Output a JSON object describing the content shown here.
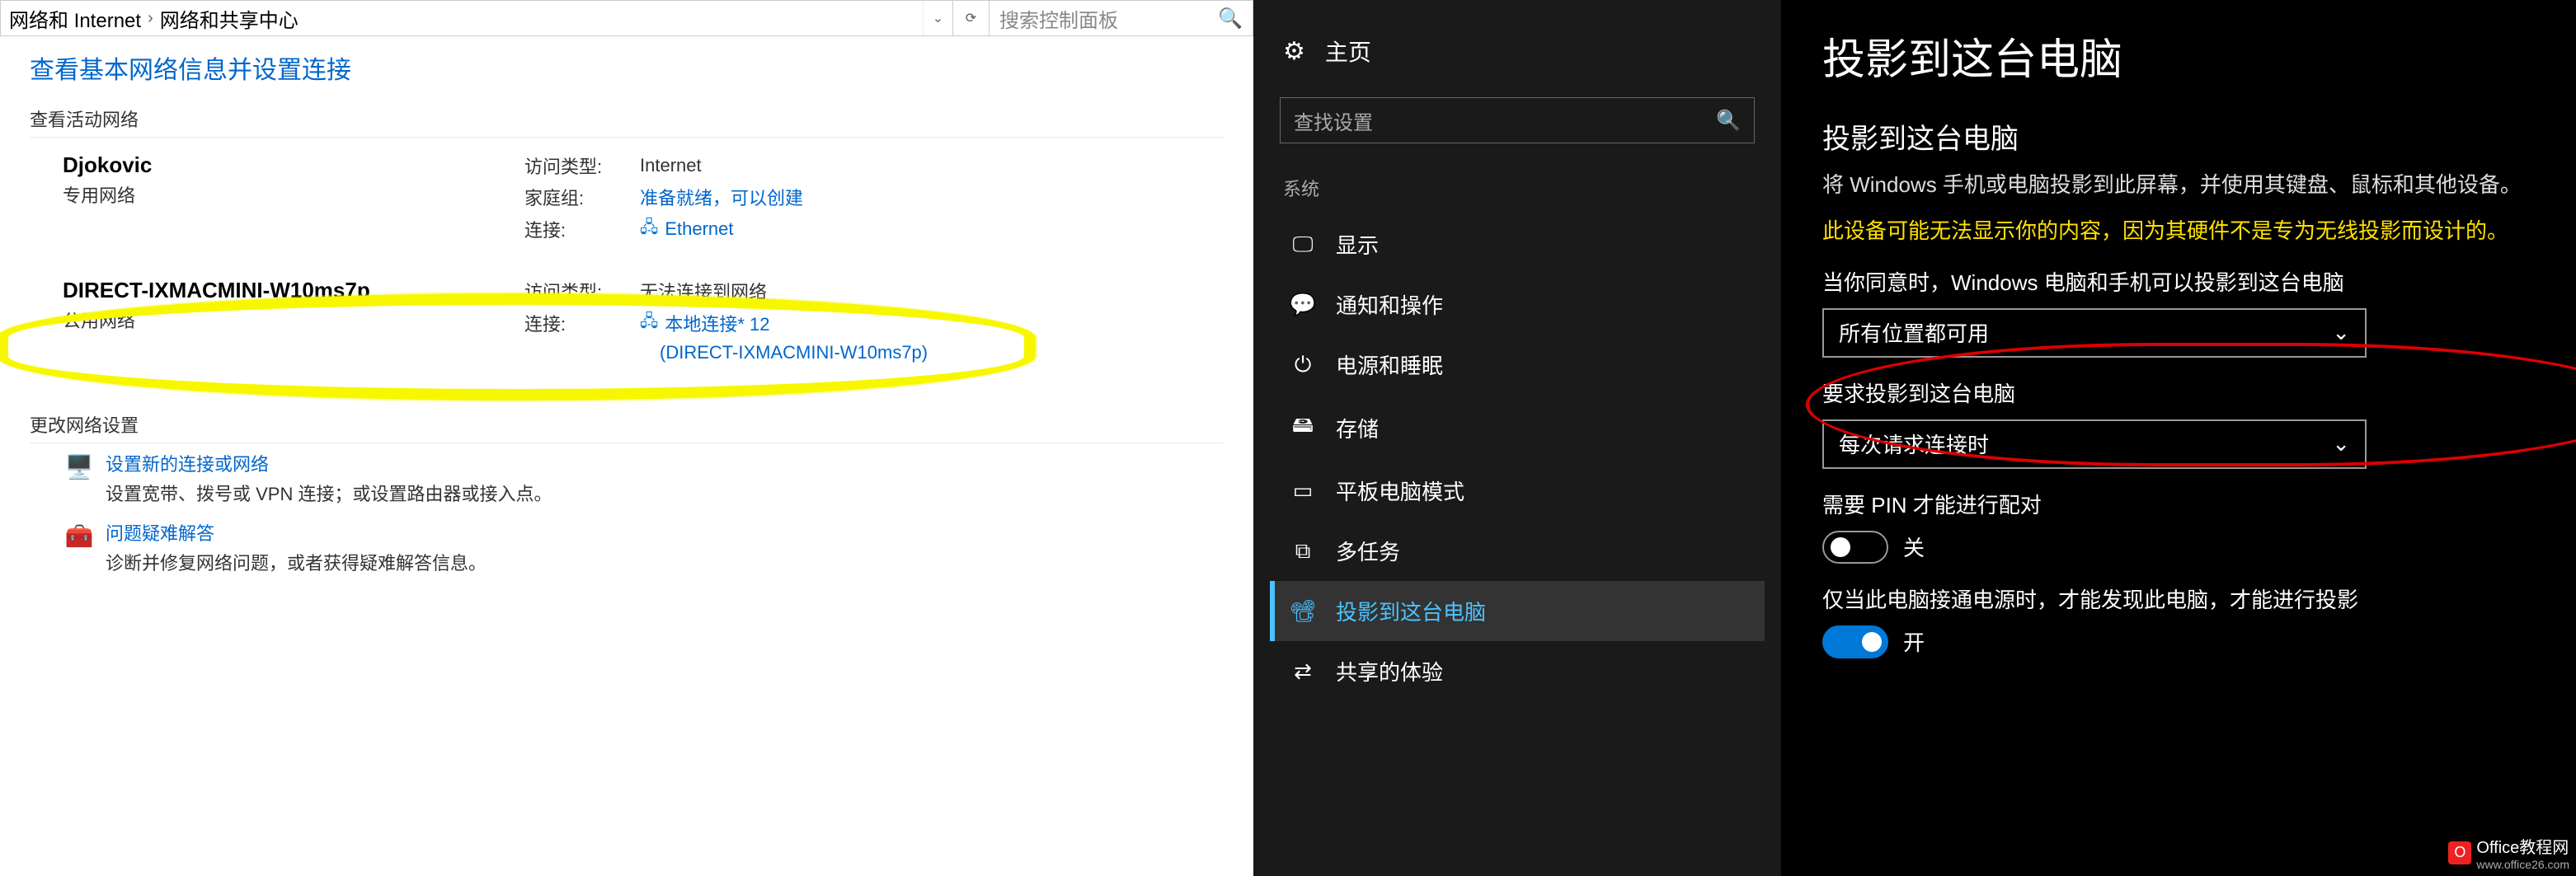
{
  "left": {
    "breadcrumb": {
      "part1": "网络和 Internet",
      "part2": "网络和共享中心"
    },
    "search_placeholder": "搜索控制面板",
    "heading": "查看基本网络信息并设置连接",
    "active_networks_label": "查看活动网络",
    "network1": {
      "name": "Djokovic",
      "type": "专用网络",
      "access_label": "访问类型:",
      "access_value": "Internet",
      "homegroup_label": "家庭组:",
      "homegroup_value": "准备就绪，可以创建",
      "conn_label": "连接:",
      "conn_value": "Ethernet"
    },
    "network2": {
      "name": "DIRECT-IXMACMINI-W10ms7p",
      "type": "公用网络",
      "access_label": "访问类型:",
      "access_value": "无法连接到网络",
      "conn_label": "连接:",
      "conn_value": "本地连接* 12",
      "conn_sub": "(DIRECT-IXMACMINI-W10ms7p)"
    },
    "change_label": "更改网络设置",
    "new_conn": {
      "title": "设置新的连接或网络",
      "desc": "设置宽带、拨号或 VPN 连接；或设置路由器或接入点。"
    },
    "troubleshoot": {
      "title": "问题疑难解答",
      "desc": "诊断并修复网络问题，或者获得疑难解答信息。"
    }
  },
  "right": {
    "home": "主页",
    "search_placeholder": "查找设置",
    "category": "系统",
    "nav": [
      {
        "icon": "display",
        "label": "显示"
      },
      {
        "icon": "notify",
        "label": "通知和操作"
      },
      {
        "icon": "power",
        "label": "电源和睡眠"
      },
      {
        "icon": "storage",
        "label": "存储"
      },
      {
        "icon": "tablet",
        "label": "平板电脑模式"
      },
      {
        "icon": "multitask",
        "label": "多任务"
      },
      {
        "icon": "project",
        "label": "投影到这台电脑"
      },
      {
        "icon": "share",
        "label": "共享的体验"
      }
    ],
    "page_title": "投影到这台电脑",
    "sub_title": "投影到这台电脑",
    "body": "将 Windows 手机或电脑投影到此屏幕，并使用其键盘、鼠标和其他设备。",
    "warning": "此设备可能无法显示你的内容，因为其硬件不是专为无线投影而设计的。",
    "dd1_label": "当你同意时，Windows 电脑和手机可以投影到这台电脑",
    "dd1_value": "所有位置都可用",
    "dd2_label": "要求投影到这台电脑",
    "dd2_value": "每次请求连接时",
    "pin_label": "需要 PIN 才能进行配对",
    "pin_state": "关",
    "power_label": "仅当此电脑接通电源时，才能发现此电脑，才能进行投影",
    "power_state": "开",
    "watermark": {
      "brand": "Office教程网",
      "url": "www.office26.com"
    }
  }
}
